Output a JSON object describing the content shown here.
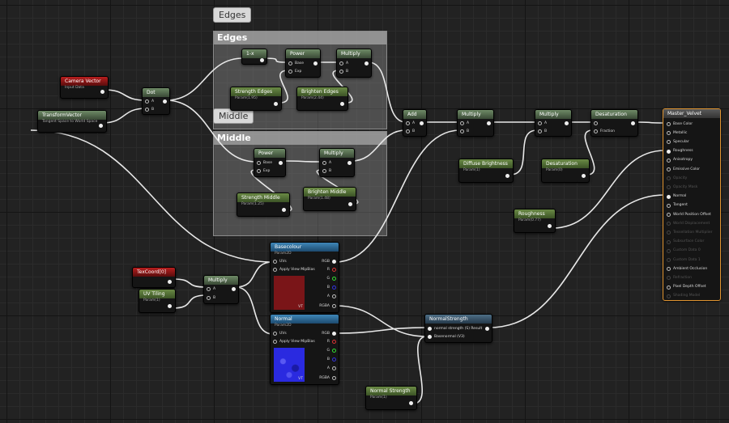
{
  "comments": {
    "edges_tab": "Edges",
    "edges_header": "Edges",
    "middle_tab": "Middle",
    "middle_header": "Middle"
  },
  "nodes": {
    "camera_vector": {
      "title": "Camera Vector",
      "sub": "Input Data"
    },
    "transform_vector": {
      "title": "TransformVector",
      "sub": "Tangent Space to World Space"
    },
    "dot": {
      "title": "Dot",
      "a": "A",
      "b": "B"
    },
    "one_minus": {
      "title": "1-x"
    },
    "power_edges": {
      "title": "Power",
      "base": "Base",
      "exp": "Exp"
    },
    "multiply_edges": {
      "title": "Multiply",
      "a": "A",
      "b": "B"
    },
    "strength_edges": {
      "title": "Strength Edges",
      "sub": "Param(1.95)"
    },
    "brighten_edges": {
      "title": "Brighten Edges",
      "sub": "Param(2.44)"
    },
    "power_middle": {
      "title": "Power",
      "base": "Base",
      "exp": "Exp"
    },
    "multiply_middle": {
      "title": "Multiply",
      "a": "A",
      "b": "B"
    },
    "strength_middle": {
      "title": "Strength Middle",
      "sub": "Param(1.25)"
    },
    "brighten_middle": {
      "title": "Brighten Middle",
      "sub": "Param(1.48)"
    },
    "add": {
      "title": "Add",
      "a": "A",
      "b": "B"
    },
    "multiply_1": {
      "title": "Multiply",
      "a": "A",
      "b": "B"
    },
    "multiply_2": {
      "title": "Multiply",
      "a": "A",
      "b": "B"
    },
    "desaturation": {
      "title": "Desaturation",
      "fraction": "Fraction"
    },
    "diffuse_brightness": {
      "title": "Diffuse Brightness",
      "sub": "Param(1)"
    },
    "desaturation_param": {
      "title": "Desaturation",
      "sub": "Param(0)"
    },
    "roughness": {
      "title": "Roughness",
      "sub": "Param(0.77)"
    },
    "texcoord": {
      "title": "TexCoord[0]"
    },
    "uv_tiling": {
      "title": "UV Tiling",
      "sub": "Param(1)"
    },
    "multiply_uv": {
      "title": "Multiply",
      "a": "A",
      "b": "B"
    },
    "basecolour": {
      "title": "Basecolour",
      "sub": "Param2D",
      "uvs": "UVs",
      "apply": "Apply View MipBias",
      "rgb": "RGB",
      "r": "R",
      "g": "G",
      "b": "B",
      "a": "A",
      "rgba": "RGBA",
      "vt": "VT",
      "color": "#7a1518"
    },
    "normal": {
      "title": "Normal",
      "sub": "Param2D",
      "uvs": "UVs",
      "apply": "Apply View MipBias",
      "rgb": "RGB",
      "r": "R",
      "g": "G",
      "b": "B",
      "a": "A",
      "rgba": "RGBA",
      "vt": "VT",
      "color": "#2a2ae0"
    },
    "normal_strength_fn": {
      "title": "NormalStrength",
      "in1": "normal strength (S) Result",
      "in2": "Basenormal (V3)"
    },
    "normal_strength_param": {
      "title": "Normal Strength",
      "sub": "Param(1)"
    },
    "master": {
      "title": "Master_Velvet",
      "pins": [
        {
          "label": "Base Color",
          "active": true,
          "filled": false
        },
        {
          "label": "Metallic",
          "active": true,
          "filled": false
        },
        {
          "label": "Specular",
          "active": true,
          "filled": false
        },
        {
          "label": "Roughness",
          "active": true,
          "filled": true
        },
        {
          "label": "Anisotropy",
          "active": true,
          "filled": false
        },
        {
          "label": "Emissive Color",
          "active": true,
          "filled": false
        },
        {
          "label": "Opacity",
          "active": false,
          "filled": false
        },
        {
          "label": "Opacity Mask",
          "active": false,
          "filled": false
        },
        {
          "label": "Normal",
          "active": true,
          "filled": true
        },
        {
          "label": "Tangent",
          "active": true,
          "filled": false
        },
        {
          "label": "World Position Offset",
          "active": true,
          "filled": false
        },
        {
          "label": "World Displacement",
          "active": false,
          "filled": false
        },
        {
          "label": "Tessellation Multiplier",
          "active": false,
          "filled": false
        },
        {
          "label": "Subsurface Color",
          "active": false,
          "filled": false
        },
        {
          "label": "Custom Data 0",
          "active": false,
          "filled": false
        },
        {
          "label": "Custom Data 1",
          "active": false,
          "filled": false
        },
        {
          "label": "Ambient Occlusion",
          "active": true,
          "filled": false
        },
        {
          "label": "Refraction",
          "active": false,
          "filled": false
        },
        {
          "label": "Pixel Depth Offset",
          "active": true,
          "filled": false
        },
        {
          "label": "Shading Model",
          "active": false,
          "filled": false
        }
      ]
    }
  },
  "colors": {
    "accent": "#e09430",
    "wire": "#e8e8e8"
  }
}
